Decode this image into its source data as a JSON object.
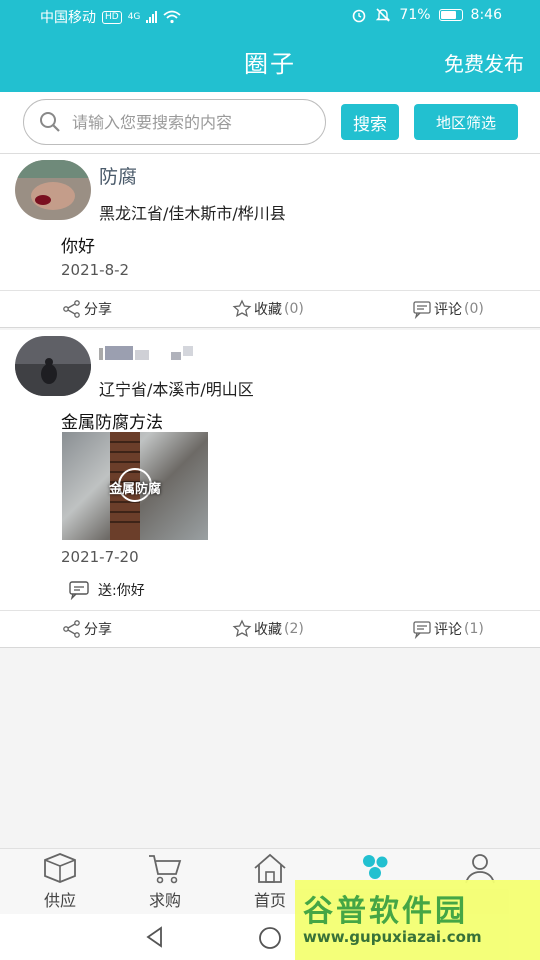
{
  "status": {
    "carrier": "中国移动",
    "network_badge": "HD",
    "network_type": "4G",
    "battery": "71%",
    "time": "8:46"
  },
  "header": {
    "title": "圈子",
    "action": "免费发布"
  },
  "search": {
    "placeholder": "请输入您要搜索的内容",
    "value": "",
    "search_button": "搜索",
    "region_button": "地区筛选"
  },
  "posts": [
    {
      "name": "防腐",
      "location": "黑龙江省/佳木斯市/桦川县",
      "content": "你好",
      "date": "2021-8-2",
      "actions": {
        "share": "分享",
        "favorite": "收藏",
        "favorite_count": "(0)",
        "comment": "评论",
        "comment_count": "(0)"
      }
    },
    {
      "name": "",
      "location": "辽宁省/本溪市/明山区",
      "content": "金属防腐方法",
      "thumbnail_text": "金属防腐",
      "date": "2021-7-20",
      "reply": "送:你好",
      "actions": {
        "share": "分享",
        "favorite": "收藏",
        "favorite_count": "(2)",
        "comment": "评论",
        "comment_count": "(1)"
      }
    }
  ],
  "bottom_nav": [
    {
      "label": "供应",
      "icon": "box-icon"
    },
    {
      "label": "求购",
      "icon": "cart-icon"
    },
    {
      "label": "首页",
      "icon": "home-icon"
    },
    {
      "label": "",
      "icon": "circle-group-icon"
    },
    {
      "label": "",
      "icon": "user-icon"
    }
  ],
  "watermark": {
    "title": "谷普软件园",
    "url": "www.gupuxiazai.com"
  },
  "colors": {
    "accent": "#22c0d0",
    "background": "#f4f4f4"
  }
}
